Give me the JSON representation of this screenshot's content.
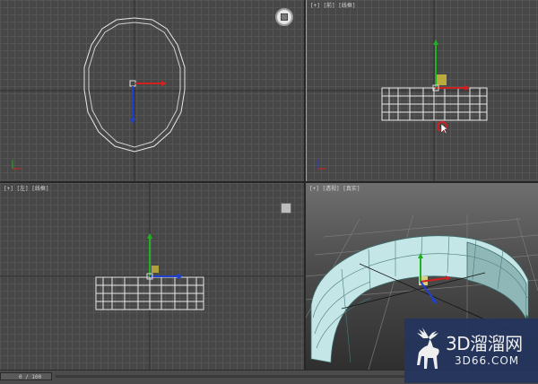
{
  "viewports": {
    "top": {
      "label": ""
    },
    "front": {
      "label": "[+] [前] [线框]"
    },
    "left": {
      "label": "[+] [左] [线框]"
    },
    "perspective": {
      "label": "[+] [透视] [真实]"
    }
  },
  "statusbar": {
    "frame_counter": "0 / 100"
  },
  "watermark": {
    "title": "3D溜溜网",
    "subtitle": "3D66.COM"
  },
  "colors": {
    "viewport_grid": "#474747",
    "grid_line": "#545454",
    "active_border": "#b8a040",
    "wireframe": "#e8e8e8",
    "gizmo_x": "#d02020",
    "gizmo_y": "#20b020",
    "gizmo_z": "#2040d0",
    "object_shaded": "#bfe3e3",
    "watermark_bg": "#24355e"
  },
  "icons": [
    "navigation-wheel-icon",
    "viewcube-icon",
    "move-gizmo-icon",
    "cursor-icon",
    "deer-logo-icon"
  ]
}
